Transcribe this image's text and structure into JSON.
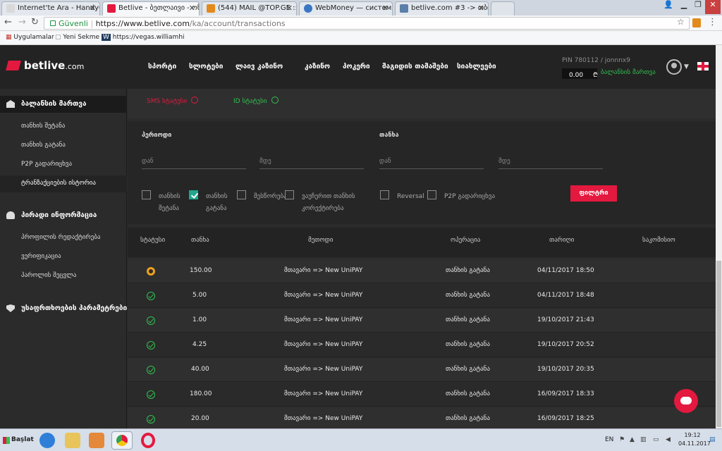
{
  "browser": {
    "tabs": [
      {
        "title": "Internet'te Ara - HandyCafe",
        "active": false
      },
      {
        "title": "Betlive - ბეთლაივი - ონლ",
        "active": true
      },
      {
        "title": "(544) MAIL @TOP.GE :: მ",
        "active": false
      },
      {
        "title": "WebMoney — система рас",
        "active": false
      },
      {
        "title": "betlive.com #3 -> თბილის",
        "active": false
      }
    ],
    "secure_label": "Güvenli",
    "url_host": "https://www.betlive.com",
    "url_path": "/ka/account/transactions",
    "bookmarks": [
      "Uygulamalar",
      "Yeni Sekme",
      "https://vegas.williamhi"
    ]
  },
  "site": {
    "logo": "betlive",
    "logo_suffix": ".com",
    "nav": [
      "სპორტი",
      "სლოტები",
      "ლაივ კაზინო",
      "კაზინო",
      "პოკერი",
      "მაგიდის თამაშები",
      "სიახლეები"
    ],
    "pin": "PIN 780112 / jonnnx9",
    "balance": "0.00",
    "currency": "₾",
    "balance_link": "ბალანსის მართვა"
  },
  "sidebar": {
    "sections": [
      {
        "label": "ბალანსის მართვა",
        "active": true
      },
      {
        "label": "პირადი ინფორმაცია",
        "active": false
      },
      {
        "label": "უსაფრთხოების პარამეტრები",
        "active": false
      }
    ],
    "balance_items": [
      {
        "label": "თანხის შეტანა",
        "active": false
      },
      {
        "label": "თანხის გატანა",
        "active": false
      },
      {
        "label": "P2P გადარიცხვა",
        "active": false
      },
      {
        "label": "ტრანზაქციების ისტორია",
        "active": true
      }
    ],
    "personal_items": [
      {
        "label": "პროფილის რედაქტირება"
      },
      {
        "label": "ვერიფიკაცია"
      },
      {
        "label": "პაროლის შეცვლა"
      }
    ]
  },
  "statuses": {
    "sms": "SMS სტატუსი",
    "id": "ID სტატუსი"
  },
  "filters": {
    "period_label": "პერიოდი",
    "amount_label": "თანხა",
    "from_placeholder": "დან",
    "to_placeholder": "მდე",
    "checkboxes": [
      {
        "line1": "თანხის",
        "line2": "შეტანა",
        "checked": false
      },
      {
        "line1": "თანხის",
        "line2": "გატანა",
        "checked": true
      },
      {
        "line1": "შესწორება",
        "line2": "",
        "checked": false
      },
      {
        "line1": "ვაუჩერით თანხის",
        "line2": "კორექტირება",
        "checked": false
      },
      {
        "line1": "Reversal",
        "line2": "",
        "checked": false
      },
      {
        "line1": "P2P გადარიცხვა",
        "line2": "",
        "checked": false
      }
    ],
    "button": "ფილტრი"
  },
  "table": {
    "headers": [
      "სტატუსი",
      "თანხა",
      "მეთოდი",
      "ოპერაცია",
      "თარიღი",
      "საკომისიო"
    ],
    "rows": [
      {
        "status": "pending",
        "amount": "150.00",
        "method": "მთავარი => New UniPAY",
        "operation": "თანხის გატანა",
        "date": "04/11/2017 18:50",
        "fee": ""
      },
      {
        "status": "ok",
        "amount": "5.00",
        "method": "მთავარი => New UniPAY",
        "operation": "თანხის გატანა",
        "date": "04/11/2017 18:48",
        "fee": ""
      },
      {
        "status": "ok",
        "amount": "1.00",
        "method": "მთავარი => New UniPAY",
        "operation": "თანხის გატანა",
        "date": "19/10/2017 21:43",
        "fee": ""
      },
      {
        "status": "ok",
        "amount": "4.25",
        "method": "მთავარი => New UniPAY",
        "operation": "თანხის გატანა",
        "date": "19/10/2017 20:52",
        "fee": ""
      },
      {
        "status": "ok",
        "amount": "40.00",
        "method": "მთავარი => New UniPAY",
        "operation": "თანხის გატანა",
        "date": "19/10/2017 20:35",
        "fee": ""
      },
      {
        "status": "ok",
        "amount": "180.00",
        "method": "მთავარი => New UniPAY",
        "operation": "თანხის გატანა",
        "date": "16/09/2017 18:33",
        "fee": ""
      },
      {
        "status": "ok",
        "amount": "20.00",
        "method": "მთავარი => New UniPAY",
        "operation": "თანხის გატანა",
        "date": "16/09/2017 18:25",
        "fee": ""
      }
    ]
  },
  "taskbar": {
    "start": "Başlat",
    "lang": "EN",
    "time": "19:12",
    "date": "04.11.2017"
  },
  "colors": {
    "accent": "#e4193f",
    "success": "#32c050",
    "pending": "#f0a21b",
    "checkbox": "#21a68d"
  }
}
